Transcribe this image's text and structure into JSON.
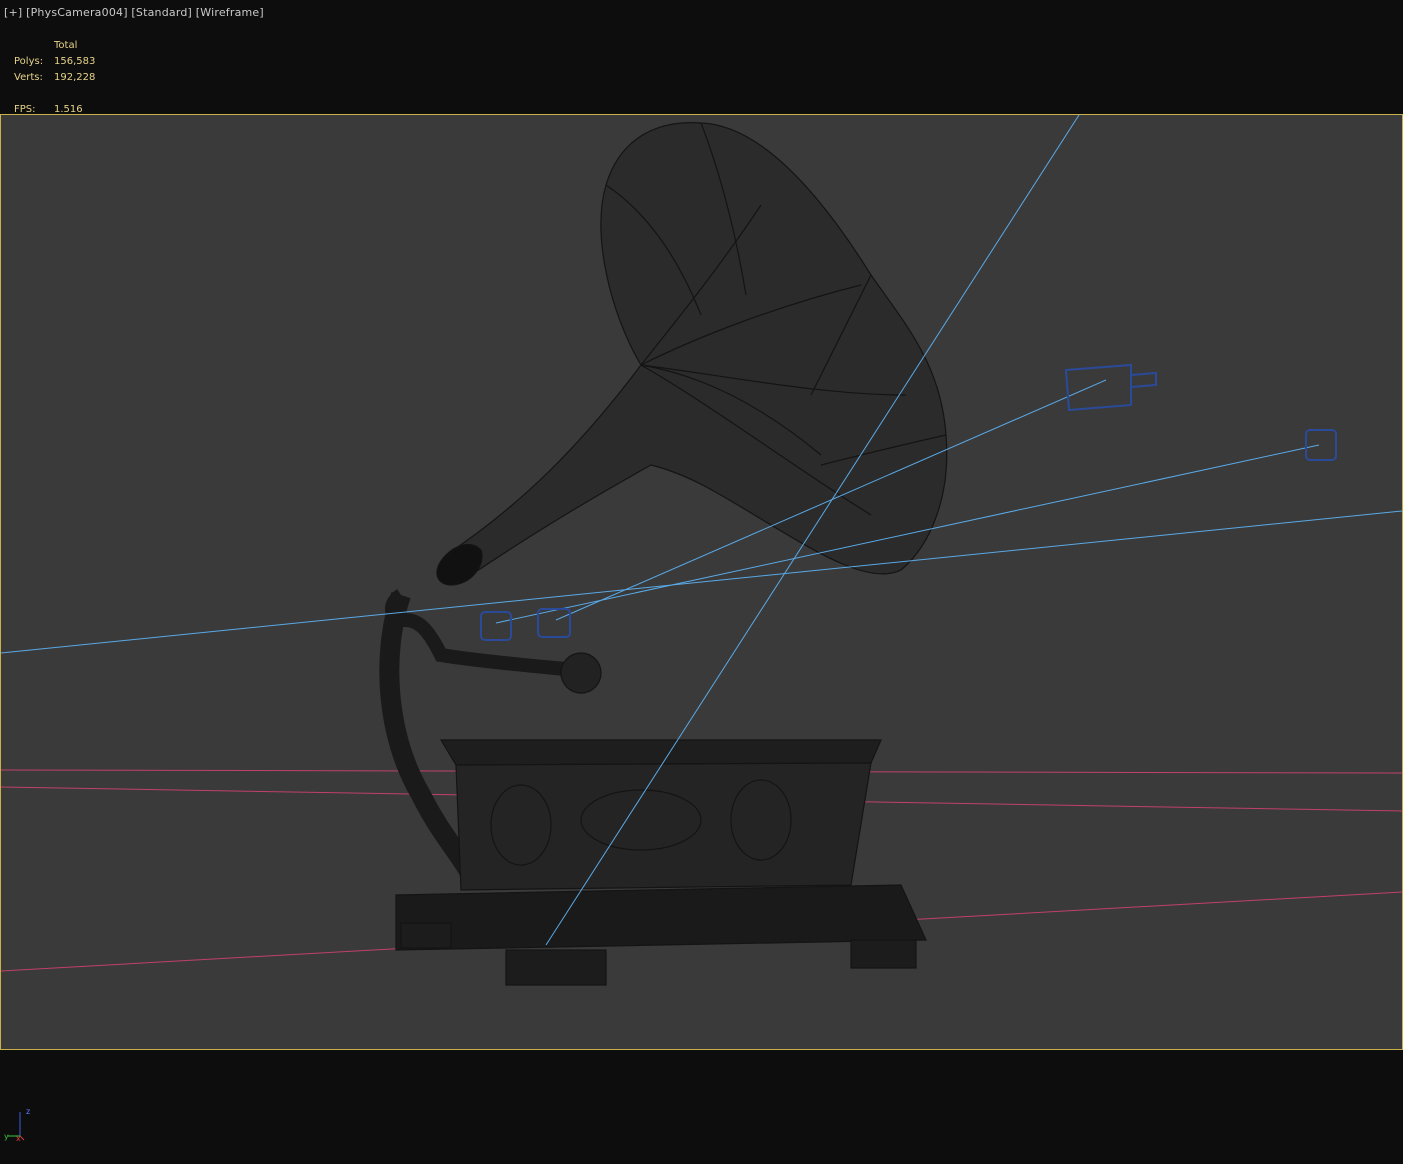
{
  "viewport_label": {
    "plus": "[+]",
    "camera": "[PhysCamera004]",
    "shading": "[Standard]",
    "mode": "[Wireframe]"
  },
  "stats": {
    "header": "Total",
    "polys_label": "Polys:",
    "polys_value": "156,583",
    "verts_label": "Verts:",
    "verts_value": "192,228",
    "fps_label": "FPS:",
    "fps_value": "1.516"
  },
  "axis": {
    "z": "z",
    "x": "x",
    "y": "y"
  },
  "colors": {
    "frame": "#c9b04a",
    "viewport_bg": "#3a3a3a",
    "stats_text": "#e6d28a",
    "camera_line": "#5aa9e6",
    "camera_icon": "#2a4a9a",
    "grid_line": "#c0406a",
    "wire": "#141414"
  }
}
